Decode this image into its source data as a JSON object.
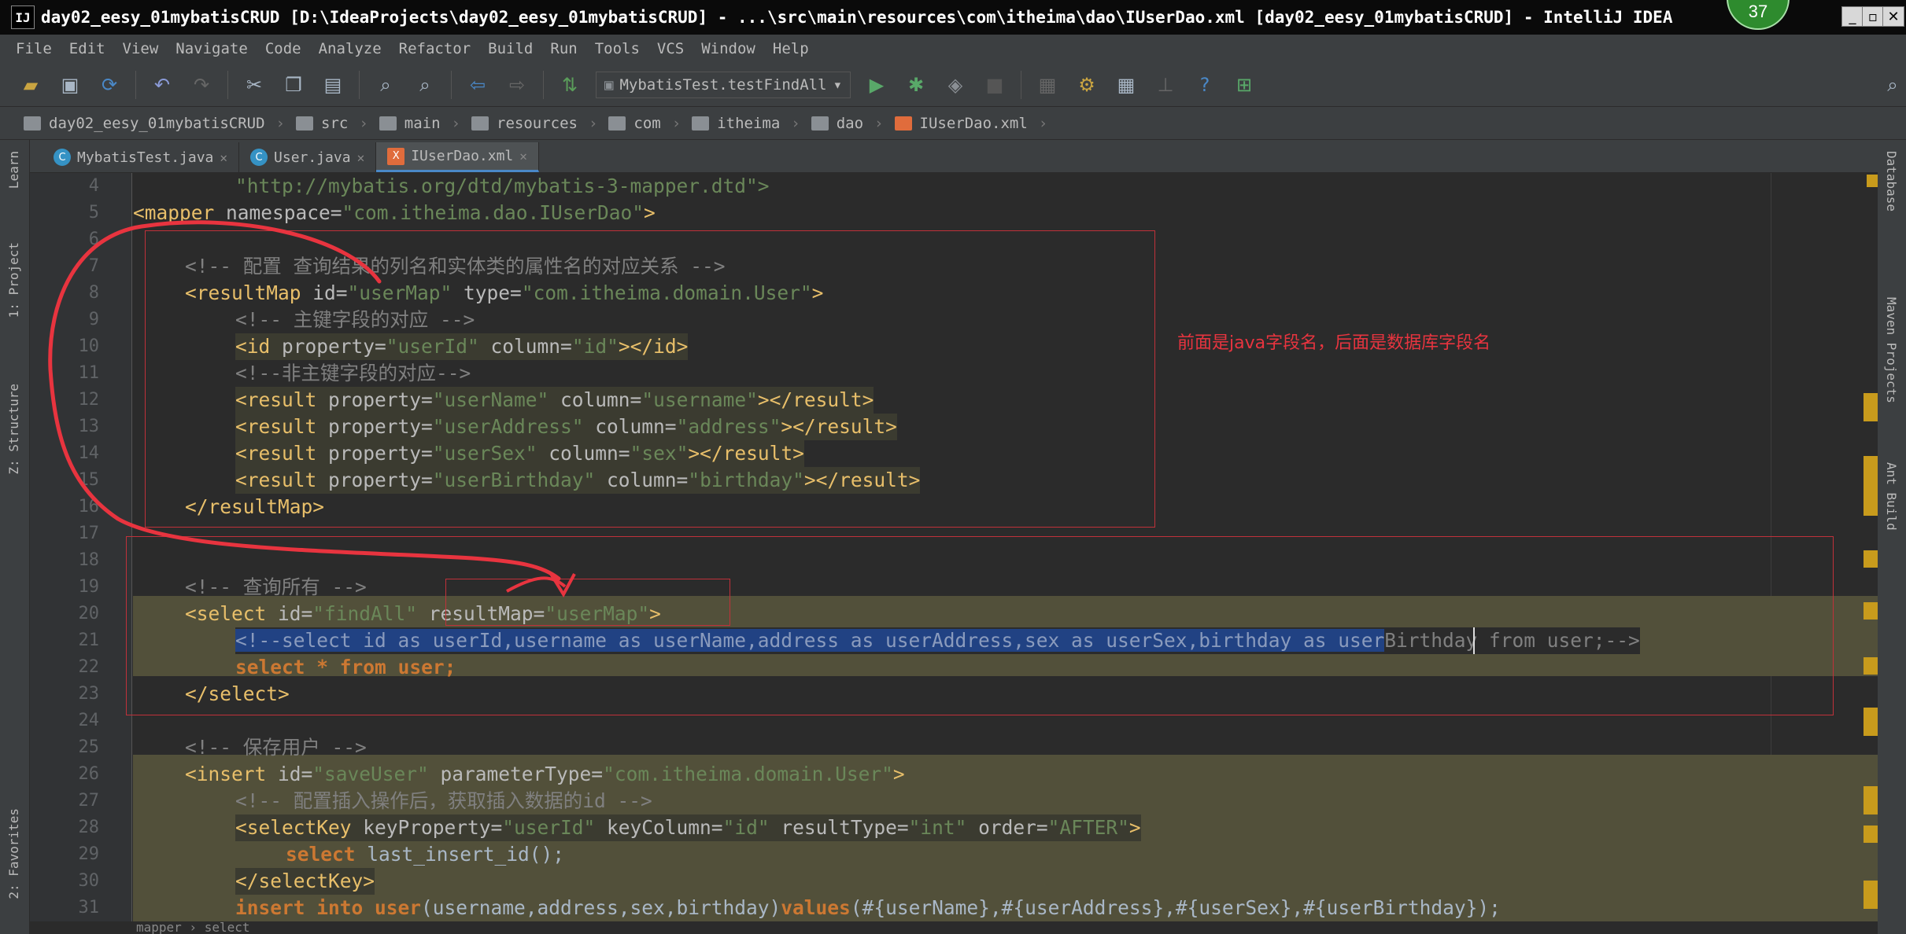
{
  "window": {
    "title": "day02_eesy_01mybatisCRUD [D:\\IdeaProjects\\day02_eesy_01mybatisCRUD] - ...\\src\\main\\resources\\com\\itheima\\dao\\IUserDao.xml [day02_eesy_01mybatisCRUD] - IntelliJ IDEA",
    "logo": "IJ",
    "badge": "37"
  },
  "menu": [
    "File",
    "Edit",
    "View",
    "Navigate",
    "Code",
    "Analyze",
    "Refactor",
    "Build",
    "Run",
    "Tools",
    "VCS",
    "Window",
    "Help"
  ],
  "toolbar": {
    "run_config": "MybatisTest.testFindAll"
  },
  "breadcrumb": [
    "day02_eesy_01mybatisCRUD",
    "src",
    "main",
    "resources",
    "com",
    "itheima",
    "dao",
    "IUserDao.xml"
  ],
  "tabs": [
    {
      "label": "MybatisTest.java",
      "icon": "C"
    },
    {
      "label": "User.java",
      "icon": "C"
    },
    {
      "label": "IUserDao.xml",
      "icon": "X",
      "active": true
    }
  ],
  "left_tools": [
    "Learn",
    "1: Project",
    "Z: Structure",
    "2: Favorites"
  ],
  "right_tools": [
    "Database",
    "Maven Projects",
    "Ant Build"
  ],
  "line_numbers": [
    "4",
    "5",
    "6",
    "7",
    "8",
    "9",
    "10",
    "11",
    "12",
    "13",
    "14",
    "15",
    "16",
    "17",
    "18",
    "19",
    "20",
    "21",
    "22",
    "23",
    "24",
    "25",
    "26",
    "27",
    "28",
    "29",
    "30",
    "31"
  ],
  "code": {
    "l4": "\"http://mybatis.org/dtd/mybatis-3-mapper.dtd\">",
    "l5_open": "<mapper",
    "l5_attr": " namespace=",
    "l5_val": "\"com.itheima.dao.IUserDao\"",
    "l5_close": ">",
    "l7": "<!-- 配置 查询结果的列名和实体类的属性名的对应关系 -->",
    "l8_open": "<resultMap",
    "l8_attr1": " id=",
    "l8_val1": "\"userMap\"",
    "l8_attr2": " type=",
    "l8_val2": "\"com.itheima.domain.User\"",
    "l8_close": ">",
    "l9": "<!-- 主键字段的对应 -->",
    "l10_open": "<id",
    "l10_attr1": " property=",
    "l10_val1": "\"userId\"",
    "l10_attr2": " column=",
    "l10_val2": "\"id\"",
    "l10_close": "></id>",
    "l11": "<!--非主键字段的对应-->",
    "l12_open": "<result",
    "l12_attr1": " property=",
    "l12_val1": "\"userName\"",
    "l12_attr2": " column=",
    "l12_val2": "\"username\"",
    "l12_close": "></result>",
    "l13_val1": "\"userAddress\"",
    "l13_val2": "\"address\"",
    "l14_val1": "\"userSex\"",
    "l14_val2": "\"sex\"",
    "l15_val1": "\"userBirthday\"",
    "l15_val2": "\"birthday\"",
    "l16": "</resultMap>",
    "l19": "<!-- 查询所有 -->",
    "l20_open": "<select",
    "l20_attr1": " id=",
    "l20_val1": "\"findAll\"",
    "l20_attr2": " resultMap=",
    "l20_val2": "\"userMap\"",
    "l20_close": ">",
    "l21_sel": "<!--select id as userId,username as userName,address as userAddress,sex as userSex,birthday as user",
    "l21_rest": "Birthday from user;-->",
    "l22_kw1": "select",
    "l22_mid": " * ",
    "l22_kw2": "from",
    "l22_sp": " ",
    "l22_kw3": "user;",
    "l23": "</select>",
    "l25": "<!-- 保存用户 -->",
    "l26_open": "<insert",
    "l26_attr1": " id=",
    "l26_val1": "\"saveUser\"",
    "l26_attr2": " parameterType=",
    "l26_val2": "\"com.itheima.domain.User\"",
    "l26_close": ">",
    "l27": "<!-- 配置插入操作后，获取插入数据的id -->",
    "l28_open": "<selectKey",
    "l28_attr1": " keyProperty=",
    "l28_val1": "\"userId\"",
    "l28_attr2": " keyColumn=",
    "l28_val2": "\"id\"",
    "l28_attr3": " resultType=",
    "l28_val3": "\"int\"",
    "l28_attr4": " order=",
    "l28_val4": "\"AFTER\"",
    "l28_close": ">",
    "l29_kw": "select",
    "l29_rest": " last_insert_id();",
    "l30": "</selectKey>",
    "l31_kw1": "insert into",
    "l31_kw2": " user",
    "l31_mid": "(username,address,sex,birthday)",
    "l31_kw3": "values",
    "l31_rest": "(#{userName},#{userAddress},#{userSex},#{userBirthday});"
  },
  "annotation_note": "前面是java字段名，后面是数据库字段名",
  "status_breadcrumb": "mapper  ›  select",
  "colors": {
    "annotation": "#e8343f",
    "tag": "#e8bf6a",
    "value": "#6a8759",
    "comment": "#808080",
    "keyword": "#cc7832",
    "selection": "#214283"
  }
}
